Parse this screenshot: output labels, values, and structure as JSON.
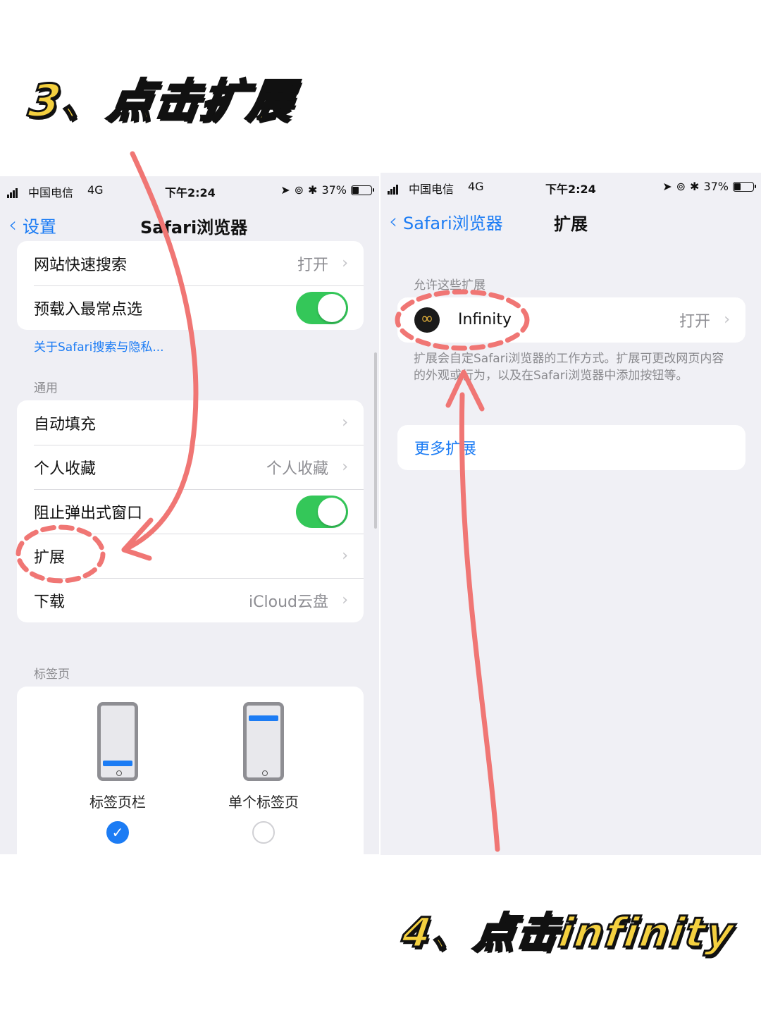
{
  "annotations": {
    "step3": "3、点击扩展",
    "step4": "4、点击infinity",
    "accent_color": "#f4d03f",
    "arrow_color": "#f07674"
  },
  "left_screen": {
    "status_bar": {
      "carrier": "中国电信",
      "network": "4G",
      "time": "下午2:24",
      "battery": "37%"
    },
    "nav": {
      "back_label": "设置",
      "title": "Safari浏览器"
    },
    "rows_top": [
      {
        "label": "网站快速搜索",
        "value": "打开"
      },
      {
        "label": "预载入最常点选",
        "toggle": true
      }
    ],
    "privacy_link": "关于Safari搜索与隐私...",
    "general_header": "通用",
    "rows_general": [
      {
        "label": "自动填充",
        "value": ""
      },
      {
        "label": "个人收藏",
        "value": "个人收藏"
      },
      {
        "label": "阻止弹出式窗口",
        "toggle": true
      },
      {
        "label": "扩展",
        "value": ""
      },
      {
        "label": "下载",
        "value": "iCloud云盘"
      }
    ],
    "tabs_header": "标签页",
    "tab_options": [
      {
        "label": "标签页栏",
        "selected": true
      },
      {
        "label": "单个标签页",
        "selected": false
      }
    ]
  },
  "right_screen": {
    "status_bar": {
      "carrier": "中国电信",
      "network": "4G",
      "time": "下午2:24",
      "battery": "37%"
    },
    "nav": {
      "back_label": "Safari浏览器",
      "title": "扩展"
    },
    "allow_header": "允许这些扩展",
    "extension": {
      "name": "Infinity",
      "value": "打开",
      "icon": "infinity-icon"
    },
    "description": "扩展会自定Safari浏览器的工作方式。扩展可更改网页内容的外观或行为，以及在Safari浏览器中添加按钮等。",
    "more_extensions": "更多扩展"
  }
}
